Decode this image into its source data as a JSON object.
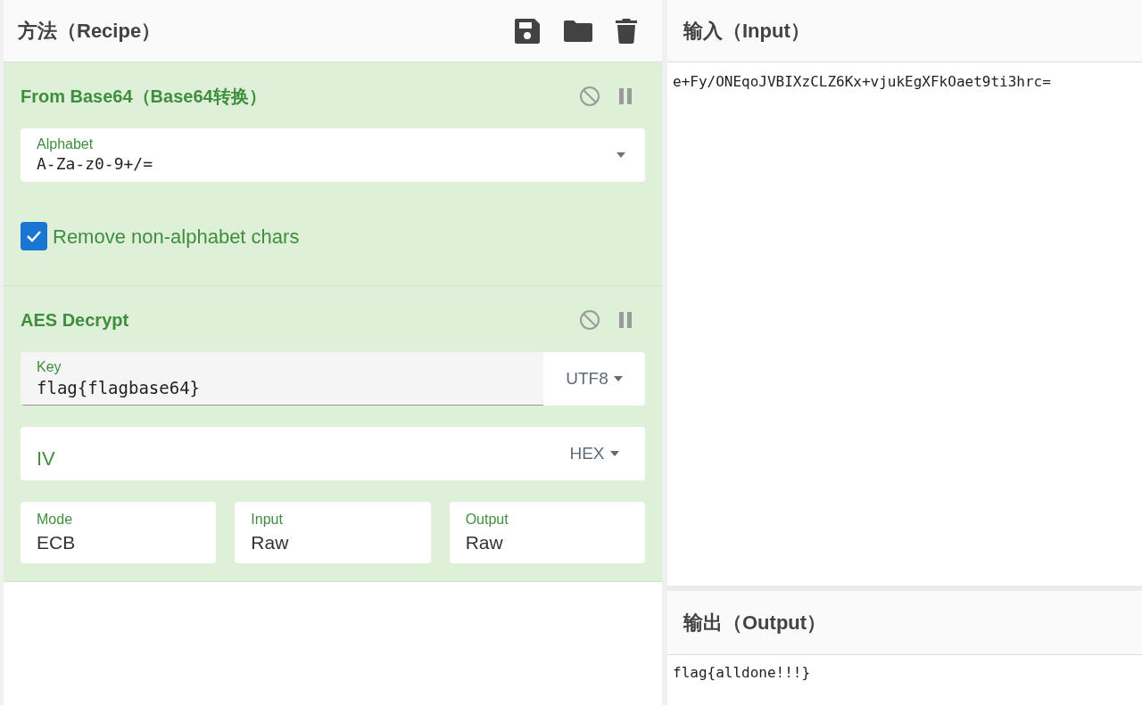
{
  "recipe": {
    "title": "方法（Recipe）"
  },
  "operations": [
    {
      "name": "From Base64（Base64转换）",
      "args": [
        {
          "kind": "dropdown",
          "label": "Alphabet",
          "value": "A-Za-z0-9+/="
        },
        {
          "kind": "checkbox",
          "label": "Remove non-alphabet chars",
          "checked": true
        }
      ]
    },
    {
      "name": "AES Decrypt",
      "args": [
        {
          "kind": "toggle",
          "label": "Key",
          "value": "flag{flagbase64}",
          "encoding": "UTF8",
          "focused": true
        },
        {
          "kind": "toggle",
          "placeholder": "IV",
          "encoding": "HEX",
          "focused": false
        },
        {
          "kind": "row",
          "fields": [
            {
              "label": "Mode",
              "value": "ECB"
            },
            {
              "label": "Input",
              "value": "Raw"
            },
            {
              "label": "Output",
              "value": "Raw"
            }
          ]
        }
      ]
    }
  ],
  "input": {
    "title": "输入（Input）",
    "text": "e+Fy/ONEqoJVBIXzCLZ6Kx+vjukEgXFkOaet9ti3hrc="
  },
  "output": {
    "title": "输出（Output）",
    "text": "flag{alldone!!!}"
  }
}
